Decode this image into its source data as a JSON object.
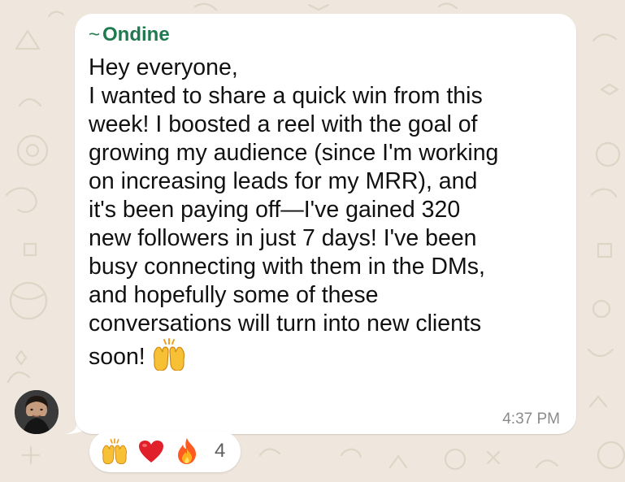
{
  "message": {
    "sender_prefix": "~",
    "sender": "Ondine",
    "lines": [
      "Hey everyone,",
      "I wanted to share a quick win from this",
      "week! I boosted a reel with the goal of",
      "growing my audience (since I'm working",
      "on increasing leads for my MRR), and",
      "it's been paying off—I've gained 320",
      "new followers in just 7 days! I've been",
      "busy connecting with them in the DMs,",
      "and hopefully some of these",
      "conversations will turn into new clients",
      "soon!"
    ],
    "inline_emoji": "raising-hands-emoji",
    "time": "4:37 PM"
  },
  "reactions": {
    "emojis": [
      "raising-hands-emoji",
      "red-heart-emoji",
      "fire-emoji"
    ],
    "count": "4"
  },
  "colors": {
    "sender": "#1f7a4f",
    "background": "#efe7dd",
    "bubble": "#ffffff",
    "timestamp": "#8b8b8b"
  }
}
